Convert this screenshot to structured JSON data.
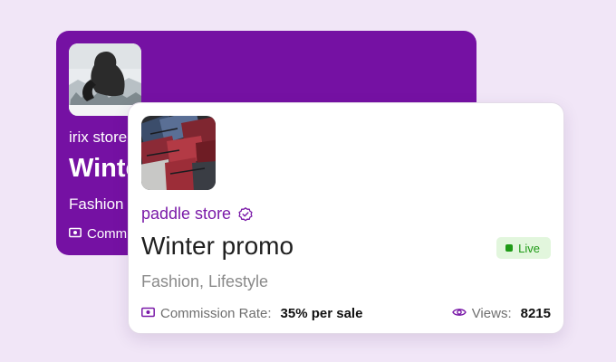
{
  "back_card": {
    "store": "irix store",
    "title": "Winte",
    "category": "Fashion",
    "commission_label": "Comm",
    "image_icon": "winter-photo-icon",
    "commission_icon": "money-icon"
  },
  "front_card": {
    "store": "paddle store",
    "verified_icon": "verified-badge-icon",
    "title": "Winter promo",
    "status": "Live",
    "category": "Fashion, Lifestyle",
    "commission_label": "Commission Rate:",
    "commission_value": "35% per sale",
    "views_label": "Views:",
    "views_value": "8215",
    "image_icon": "jackets-photo-icon",
    "commission_icon": "money-icon",
    "views_icon": "eye-icon"
  },
  "colors": {
    "page_bg": "#f1e6f7",
    "brand_purple": "#7511a3",
    "store_purple": "#7a1aa8",
    "live_green": "#1f9a17",
    "live_bg": "#e2f6dd"
  }
}
